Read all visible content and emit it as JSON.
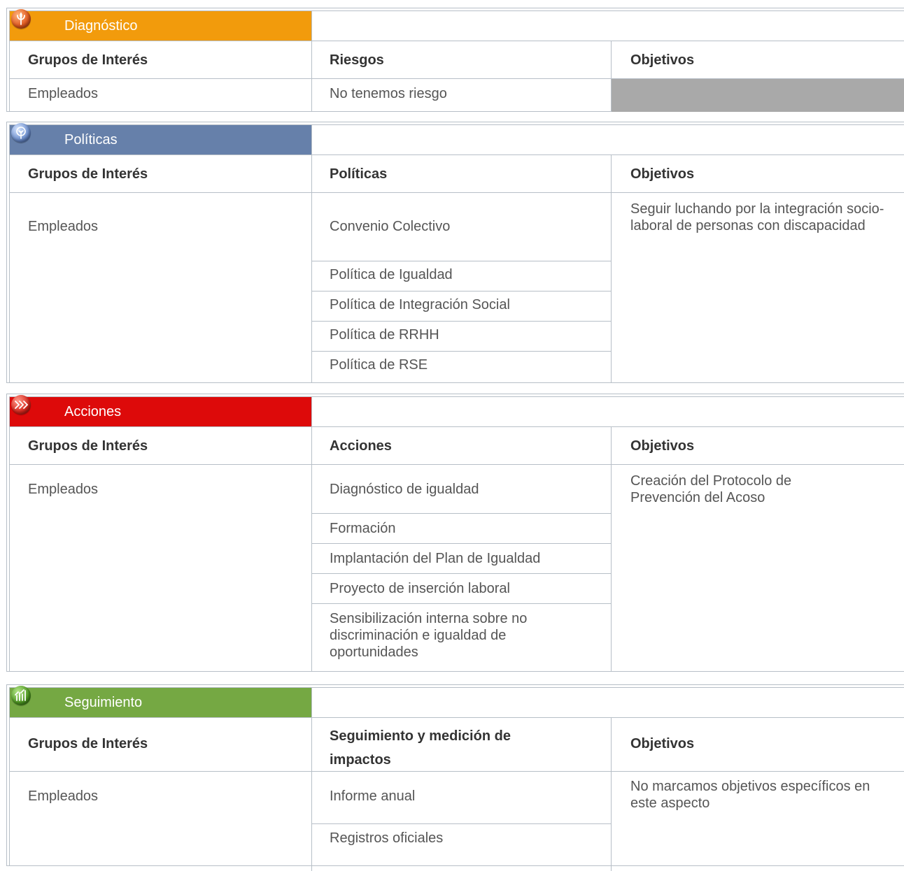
{
  "diagnostico": {
    "title": "Diagnóstico",
    "icon": "sprout-icon",
    "color": "#f29b0c",
    "headers": [
      "Grupos de Interés",
      "Riesgos",
      "Objetivos"
    ],
    "row": {
      "grupo": "Empleados",
      "riesgo": "No tenemos riesgo",
      "objetivo": ""
    }
  },
  "politicas": {
    "title": "Políticas",
    "icon": "tree-icon",
    "color": "#6680aa",
    "headers": [
      "Grupos de Interés",
      "Políticas",
      "Objetivos"
    ],
    "grupo": "Empleados",
    "items": [
      "Convenio Colectivo",
      "Política de Igualdad",
      "Política de Integración Social",
      "Política de RRHH",
      "Política de RSE"
    ],
    "objetivo": "Seguir luchando por la integración socio-laboral de personas con discapacidad"
  },
  "acciones": {
    "title": "Acciones",
    "icon": "branches-icon",
    "color": "#dd0a0a",
    "headers": [
      "Grupos de Interés",
      "Acciones",
      "Objetivos"
    ],
    "grupo": "Empleados",
    "items": [
      "Diagnóstico de igualdad",
      "Formación",
      "Implantación del Plan de Igualdad",
      "Proyecto de inserción laboral",
      "Sensibilización interna sobre no discriminación e igualdad de oportunidades"
    ],
    "objetivo": "Creación del Protocolo de Prevención del Acoso"
  },
  "seguimiento": {
    "title": "Seguimiento",
    "icon": "growth-icon",
    "color": "#75a843",
    "headers": [
      "Grupos de Interés",
      "Seguimiento y medición de impactos",
      "Objetivos"
    ],
    "grupo": "Empleados",
    "items": [
      "Informe anual",
      "Registros oficiales"
    ],
    "objetivo": "No marcamos objetivos específicos en este aspecto"
  }
}
